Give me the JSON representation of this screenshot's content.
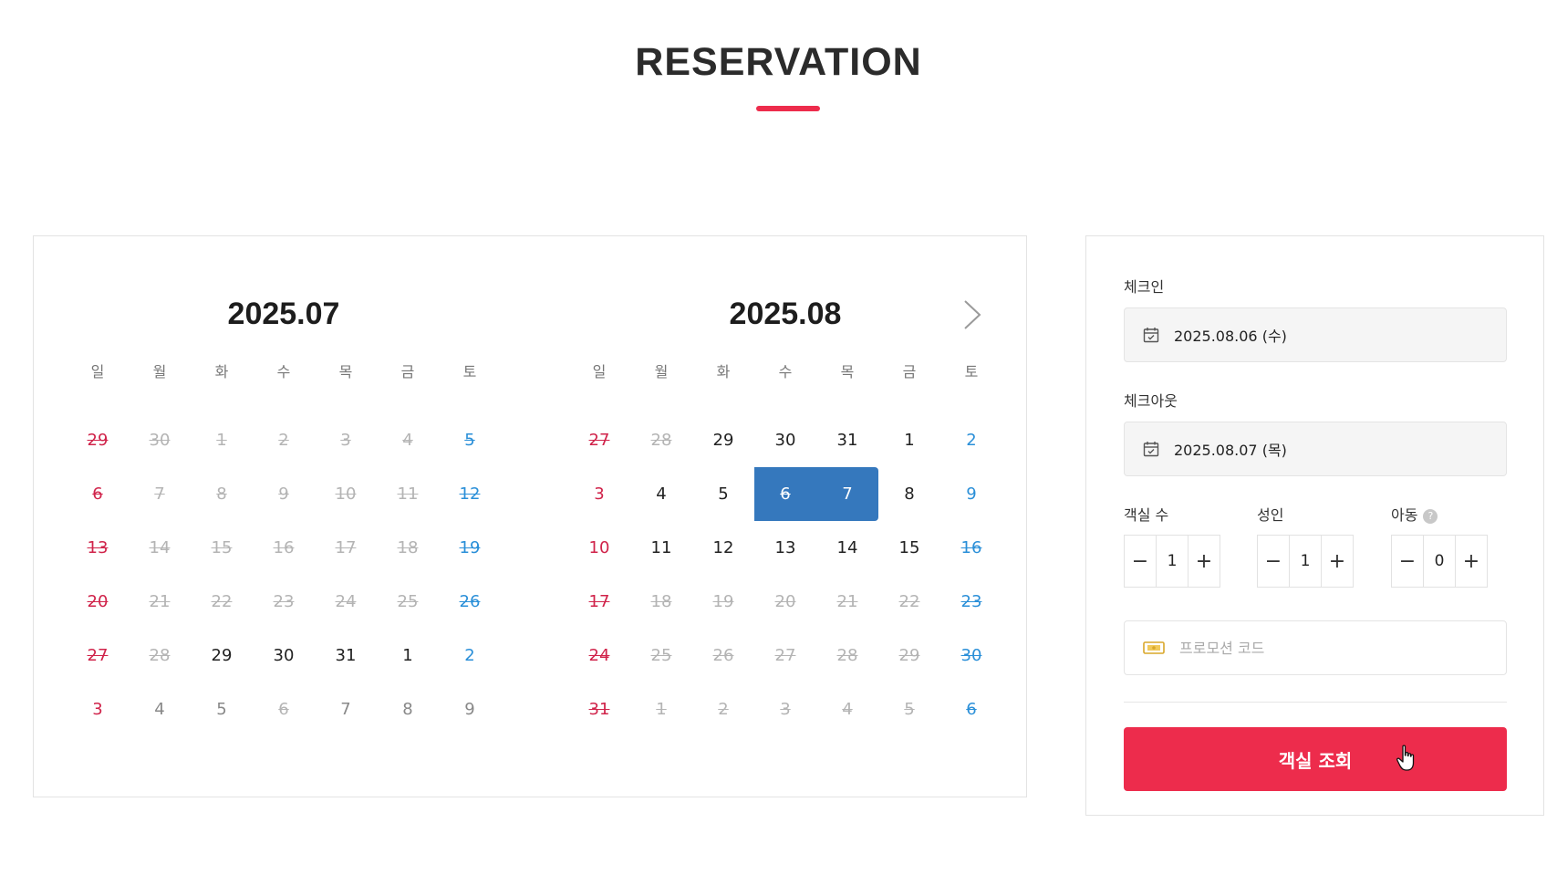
{
  "page": {
    "title": "RESERVATION"
  },
  "calendar": {
    "weekdays": [
      "일",
      "월",
      "화",
      "수",
      "목",
      "금",
      "토"
    ],
    "months": [
      {
        "title": "2025.07",
        "weeks": [
          [
            "29",
            "30",
            "1",
            "2",
            "3",
            "4",
            "5"
          ],
          [
            "6",
            "7",
            "8",
            "9",
            "10",
            "11",
            "12"
          ],
          [
            "13",
            "14",
            "15",
            "16",
            "17",
            "18",
            "19"
          ],
          [
            "20",
            "21",
            "22",
            "23",
            "24",
            "25",
            "26"
          ],
          [
            "27",
            "28",
            "29",
            "30",
            "31",
            "1",
            "2"
          ],
          [
            "3",
            "4",
            "5",
            "6",
            "7",
            "8",
            "9"
          ]
        ]
      },
      {
        "title": "2025.08",
        "weeks": [
          [
            "27",
            "28",
            "29",
            "30",
            "31",
            "1",
            "2"
          ],
          [
            "3",
            "4",
            "5",
            "6",
            "7",
            "8",
            "9"
          ],
          [
            "10",
            "11",
            "12",
            "13",
            "14",
            "15",
            "16"
          ],
          [
            "17",
            "18",
            "19",
            "20",
            "21",
            "22",
            "23"
          ],
          [
            "24",
            "25",
            "26",
            "27",
            "28",
            "29",
            "30"
          ],
          [
            "31",
            "1",
            "2",
            "3",
            "4",
            "5",
            "6"
          ]
        ]
      }
    ],
    "next_icon": "chevron-right-icon"
  },
  "booking": {
    "checkin_label": "체크인",
    "checkin_value": "2025.08.06 (수)",
    "checkout_label": "체크아웃",
    "checkout_value": "2025.08.07 (목)",
    "rooms_label": "객실 수",
    "rooms_value": "1",
    "adults_label": "성인",
    "adults_value": "1",
    "children_label": "아동",
    "children_value": "0",
    "minus_symbol": "−",
    "plus_symbol": "+",
    "promo_placeholder": "프로모션 코드",
    "search_label": "객실 조회"
  },
  "colors": {
    "accent": "#ed2c4c",
    "selected": "#3578bd",
    "sunday": "#d0234a",
    "saturday": "#2a8fd8"
  }
}
